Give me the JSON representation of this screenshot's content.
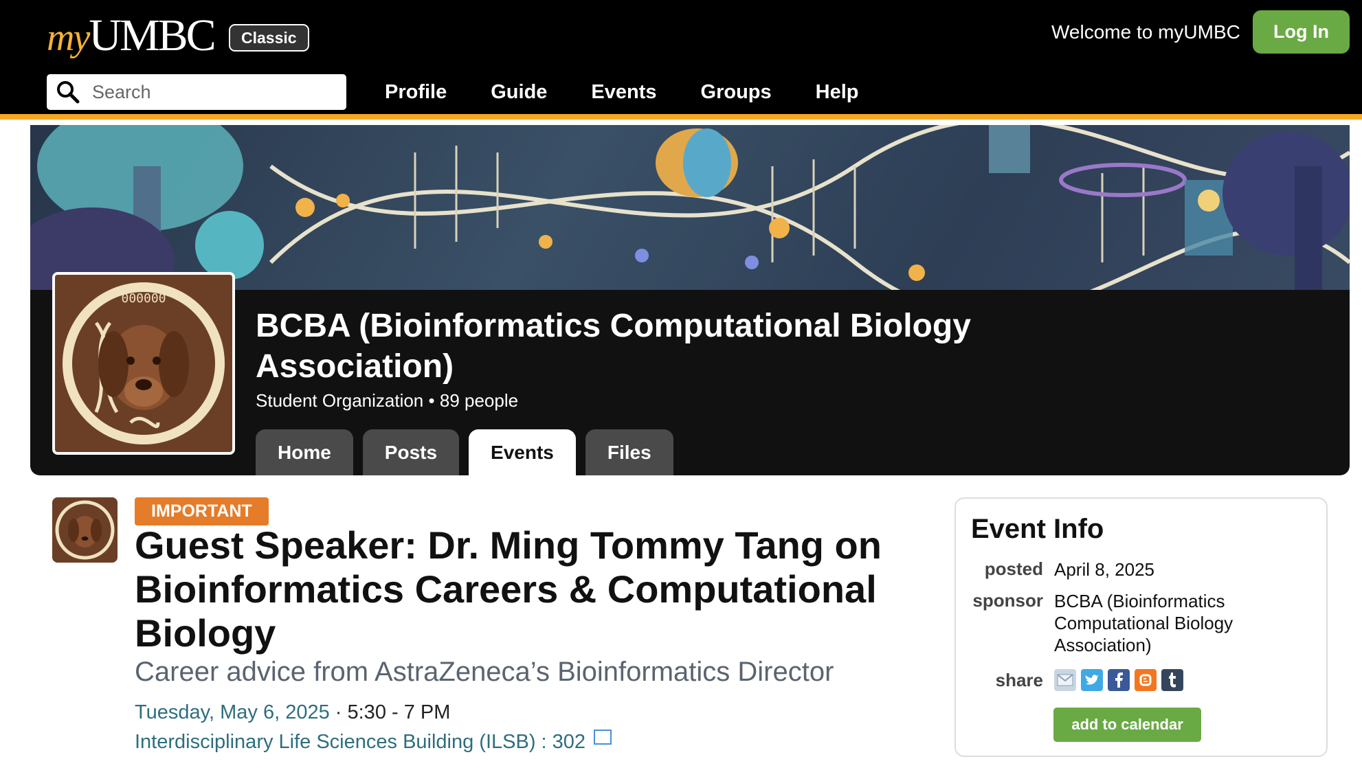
{
  "header": {
    "logo_prefix": "my",
    "logo_name": "UMBC",
    "classic_badge": "Classic",
    "welcome_text": "Welcome to myUMBC",
    "login_label": "Log In",
    "search_placeholder": "Search",
    "nav": [
      "Profile",
      "Guide",
      "Events",
      "Groups",
      "Help"
    ]
  },
  "group": {
    "name": "BCBA (Bioinformatics Computational Biology Association)",
    "type": "Student Organization",
    "separator": "•",
    "members": "89 people",
    "tabs": [
      "Home",
      "Posts",
      "Events",
      "Files"
    ],
    "active_tab": "Events"
  },
  "event": {
    "badge": "IMPORTANT",
    "title": "Guest Speaker: Dr. Ming Tommy Tang on Bioinformatics Careers & Computational Biology",
    "subtitle": "Career advice from AstraZeneca’s Bioinformatics Director",
    "date": "Tuesday, May 6, 2025",
    "time_separator": " · ",
    "time": "5:30 - 7 PM",
    "location": "Interdisciplinary Life Sciences Building (ILSB) : 302"
  },
  "event_info": {
    "title": "Event Info",
    "posted_label": "posted",
    "posted_value": "April 8, 2025",
    "sponsor_label": "sponsor",
    "sponsor_value": "BCBA (Bioinformatics Computational Biology Association)",
    "share_label": "share",
    "share_icons": [
      "email-icon",
      "twitter-icon",
      "facebook-icon",
      "blogger-icon",
      "tumblr-icon"
    ],
    "add_to_calendar": "add to calendar"
  },
  "colors": {
    "accent_orange": "#f5a623",
    "login_green": "#6aaa45",
    "badge_orange": "#e57c2a",
    "link_teal": "#2d6e7e"
  }
}
